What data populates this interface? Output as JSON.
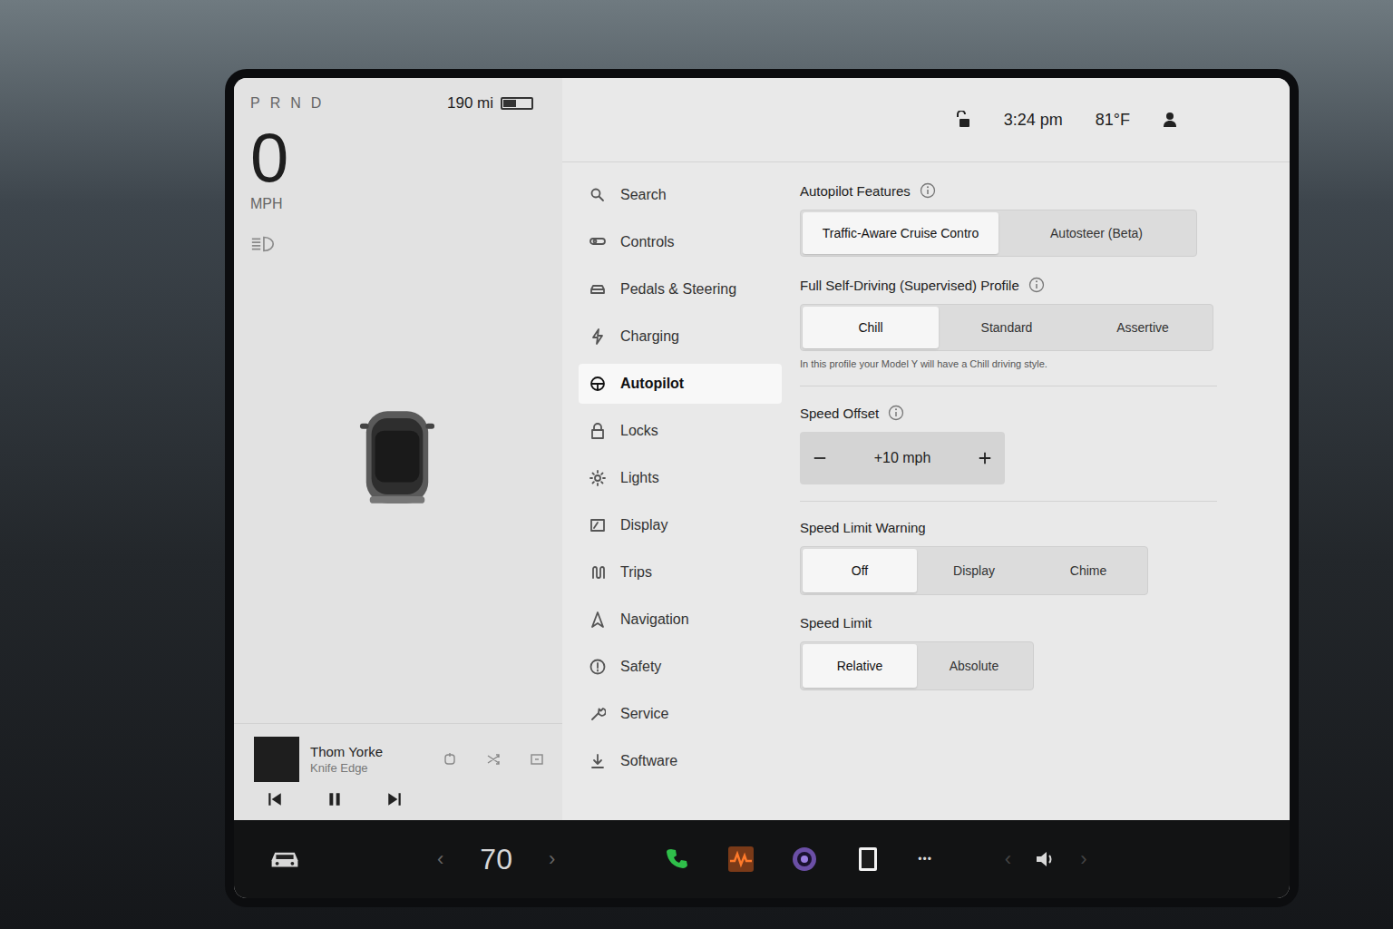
{
  "status": {
    "gears": [
      "P",
      "R",
      "N",
      "D"
    ],
    "speed": "0",
    "speed_unit": "MPH",
    "range": "190 mi",
    "battery_level": 0.45
  },
  "header": {
    "locked": false,
    "time": "3:24 pm",
    "temperature": "81°F"
  },
  "media": {
    "artist": "Thom Yorke",
    "track": "Knife Edge",
    "playing": true
  },
  "menu": [
    {
      "label": "Search",
      "selected": false
    },
    {
      "label": "Controls",
      "selected": false
    },
    {
      "label": "Pedals & Steering",
      "selected": false
    },
    {
      "label": "Charging",
      "selected": false
    },
    {
      "label": "Autopilot",
      "selected": true
    },
    {
      "label": "Locks",
      "selected": false
    },
    {
      "label": "Lights",
      "selected": false
    },
    {
      "label": "Display",
      "selected": false
    },
    {
      "label": "Trips",
      "selected": false
    },
    {
      "label": "Navigation",
      "selected": false
    },
    {
      "label": "Safety",
      "selected": false
    },
    {
      "label": "Service",
      "selected": false
    },
    {
      "label": "Software",
      "selected": false
    }
  ],
  "settings": {
    "autopilot_features": {
      "label": "Autopilot Features",
      "options": [
        {
          "label": "Traffic-Aware Cruise Contro",
          "selected": true
        },
        {
          "label": "Autosteer (Beta)",
          "selected": false
        }
      ]
    },
    "profile": {
      "label": "Full Self-Driving (Supervised) Profile",
      "options": [
        {
          "label": "Chill",
          "selected": true
        },
        {
          "label": "Standard",
          "selected": false
        },
        {
          "label": "Assertive",
          "selected": false
        }
      ],
      "description": "In this profile your Model Y will have a Chill driving style."
    },
    "speed_offset": {
      "label": "Speed Offset",
      "value": "+10 mph"
    },
    "speed_limit_warning": {
      "label": "Speed Limit Warning",
      "options": [
        {
          "label": "Off",
          "selected": true
        },
        {
          "label": "Display",
          "selected": false
        },
        {
          "label": "Chime",
          "selected": false
        }
      ]
    },
    "speed_limit": {
      "label": "Speed Limit",
      "options": [
        {
          "label": "Relative",
          "selected": true
        },
        {
          "label": "Absolute",
          "selected": false
        }
      ]
    }
  },
  "dock": {
    "temperature": "70",
    "left_arrow": "‹",
    "right_arrow": "›",
    "more": "•••",
    "volume_left": "‹",
    "volume_right": "›"
  }
}
